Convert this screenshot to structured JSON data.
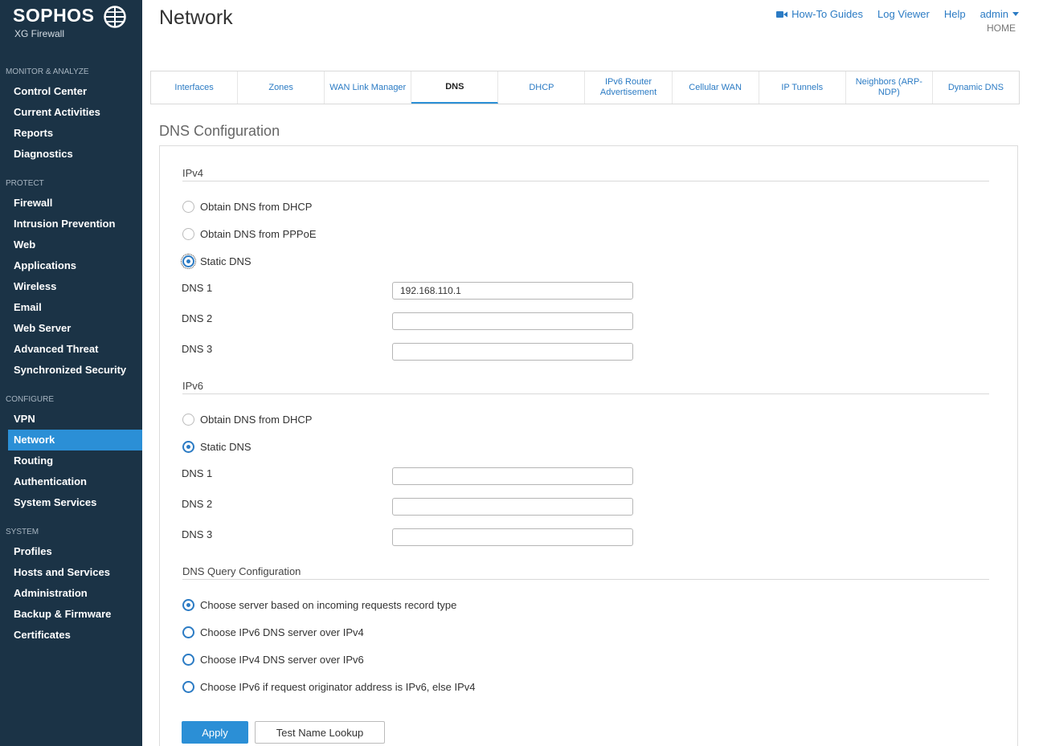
{
  "brand": {
    "name": "SOPHOS",
    "product": "XG Firewall"
  },
  "sidebar": {
    "sections": [
      {
        "label": "MONITOR & ANALYZE",
        "items": [
          "Control Center",
          "Current Activities",
          "Reports",
          "Diagnostics"
        ]
      },
      {
        "label": "PROTECT",
        "items": [
          "Firewall",
          "Intrusion Prevention",
          "Web",
          "Applications",
          "Wireless",
          "Email",
          "Web Server",
          "Advanced Threat",
          "Synchronized Security"
        ]
      },
      {
        "label": "CONFIGURE",
        "items": [
          "VPN",
          "Network",
          "Routing",
          "Authentication",
          "System Services"
        ]
      },
      {
        "label": "SYSTEM",
        "items": [
          "Profiles",
          "Hosts and Services",
          "Administration",
          "Backup & Firmware",
          "Certificates"
        ]
      }
    ],
    "active_item": "Network"
  },
  "header": {
    "title": "Network",
    "links": {
      "howto": "How-To Guides",
      "logviewer": "Log Viewer",
      "help": "Help",
      "user": "admin"
    },
    "home": "HOME"
  },
  "tabs": [
    "Interfaces",
    "Zones",
    "WAN Link Manager",
    "DNS",
    "DHCP",
    "IPv6 Router Advertisement",
    "Cellular WAN",
    "IP Tunnels",
    "Neighbors (ARP-NDP)",
    "Dynamic DNS"
  ],
  "active_tab": "DNS",
  "dns": {
    "title": "DNS Configuration",
    "ipv4": {
      "title": "IPv4",
      "options": [
        "Obtain DNS from DHCP",
        "Obtain DNS from PPPoE",
        "Static DNS"
      ],
      "selected": "Static DNS",
      "fields": [
        {
          "label": "DNS 1",
          "value": "192.168.110.1"
        },
        {
          "label": "DNS 2",
          "value": ""
        },
        {
          "label": "DNS 3",
          "value": ""
        }
      ]
    },
    "ipv6": {
      "title": "IPv6",
      "options": [
        "Obtain DNS from DHCP",
        "Static DNS"
      ],
      "selected": "Static DNS",
      "fields": [
        {
          "label": "DNS 1",
          "value": ""
        },
        {
          "label": "DNS 2",
          "value": ""
        },
        {
          "label": "DNS 3",
          "value": ""
        }
      ]
    },
    "query": {
      "title": "DNS Query Configuration",
      "options": [
        "Choose server based on incoming requests record type",
        "Choose IPv6 DNS server over IPv4",
        "Choose IPv4 DNS server over IPv6",
        "Choose IPv6 if request originator address is IPv6, else IPv4"
      ],
      "selected": "Choose server based on incoming requests record type"
    },
    "buttons": {
      "apply": "Apply",
      "test": "Test Name Lookup"
    }
  },
  "colors": {
    "sidebar_bg": "#1b3346",
    "accent": "#2b8fd6",
    "link": "#2b7bc4"
  }
}
